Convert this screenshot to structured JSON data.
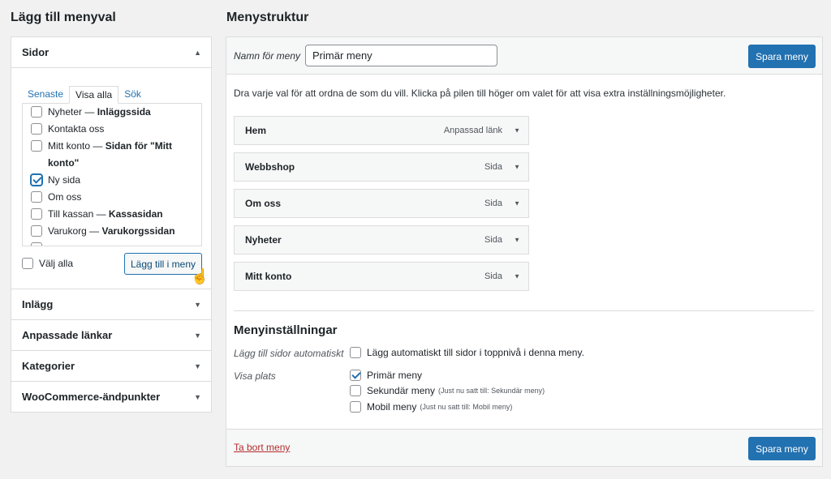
{
  "left": {
    "title": "Lägg till menyval",
    "sidor": {
      "label": "Sidor",
      "tabs": [
        "Senaste",
        "Visa alla",
        "Sök"
      ],
      "pages": [
        {
          "name": "Nyheter",
          "suffix": "Inläggssida",
          "checked": false
        },
        {
          "name": "Kontakta oss",
          "suffix": "",
          "checked": false
        },
        {
          "name": "Mitt konto",
          "suffix": "Sidan för \"Mitt konto\"",
          "checked": false
        },
        {
          "name": "Ny sida",
          "suffix": "",
          "checked": true
        },
        {
          "name": "Om oss",
          "suffix": "",
          "checked": false
        },
        {
          "name": "Till kassan",
          "suffix": "Kassasidan",
          "checked": false
        },
        {
          "name": "Varukorg",
          "suffix": "Varukorgssidan",
          "checked": false
        }
      ],
      "select_all": "Välj alla",
      "add_button": "Lägg till i meny"
    },
    "sections": [
      "Inlägg",
      "Anpassade länkar",
      "Kategorier",
      "WooCommerce-ändpunkter"
    ]
  },
  "right": {
    "title": "Menystruktur",
    "menu_name_label": "Namn för meny",
    "menu_name_value": "Primär meny",
    "save_label": "Spara meny",
    "instructions": "Dra varje val för att ordna de som du vill. Klicka på pilen till höger om valet för att visa extra inställningsmöjligheter.",
    "items": [
      {
        "title": "Hem",
        "type": "Anpassad länk"
      },
      {
        "title": "Webbshop",
        "type": "Sida"
      },
      {
        "title": "Om oss",
        "type": "Sida"
      },
      {
        "title": "Nyheter",
        "type": "Sida"
      },
      {
        "title": "Mitt konto",
        "type": "Sida"
      }
    ],
    "settings": {
      "title": "Menyinställningar",
      "auto_add_label": "Lägg till sidor automatiskt",
      "auto_add_option": "Lägg automatiskt till sidor i toppnivå i denna meny.",
      "location_label": "Visa plats",
      "locations": [
        {
          "name": "Primär meny",
          "note": "",
          "checked": true
        },
        {
          "name": "Sekundär meny",
          "note": "(Just nu satt till: Sekundär meny)",
          "checked": false
        },
        {
          "name": "Mobil meny",
          "note": "(Just nu satt till: Mobil meny)",
          "checked": false
        }
      ]
    },
    "delete_label": "Ta bort meny"
  },
  "colors": {
    "accent": "#2271b1",
    "danger": "#b32d2e",
    "background": "#f1f1f1"
  },
  "icons": {
    "expand": "triangle-down",
    "collapse": "triangle-up",
    "cursor": "hand-pointer"
  }
}
